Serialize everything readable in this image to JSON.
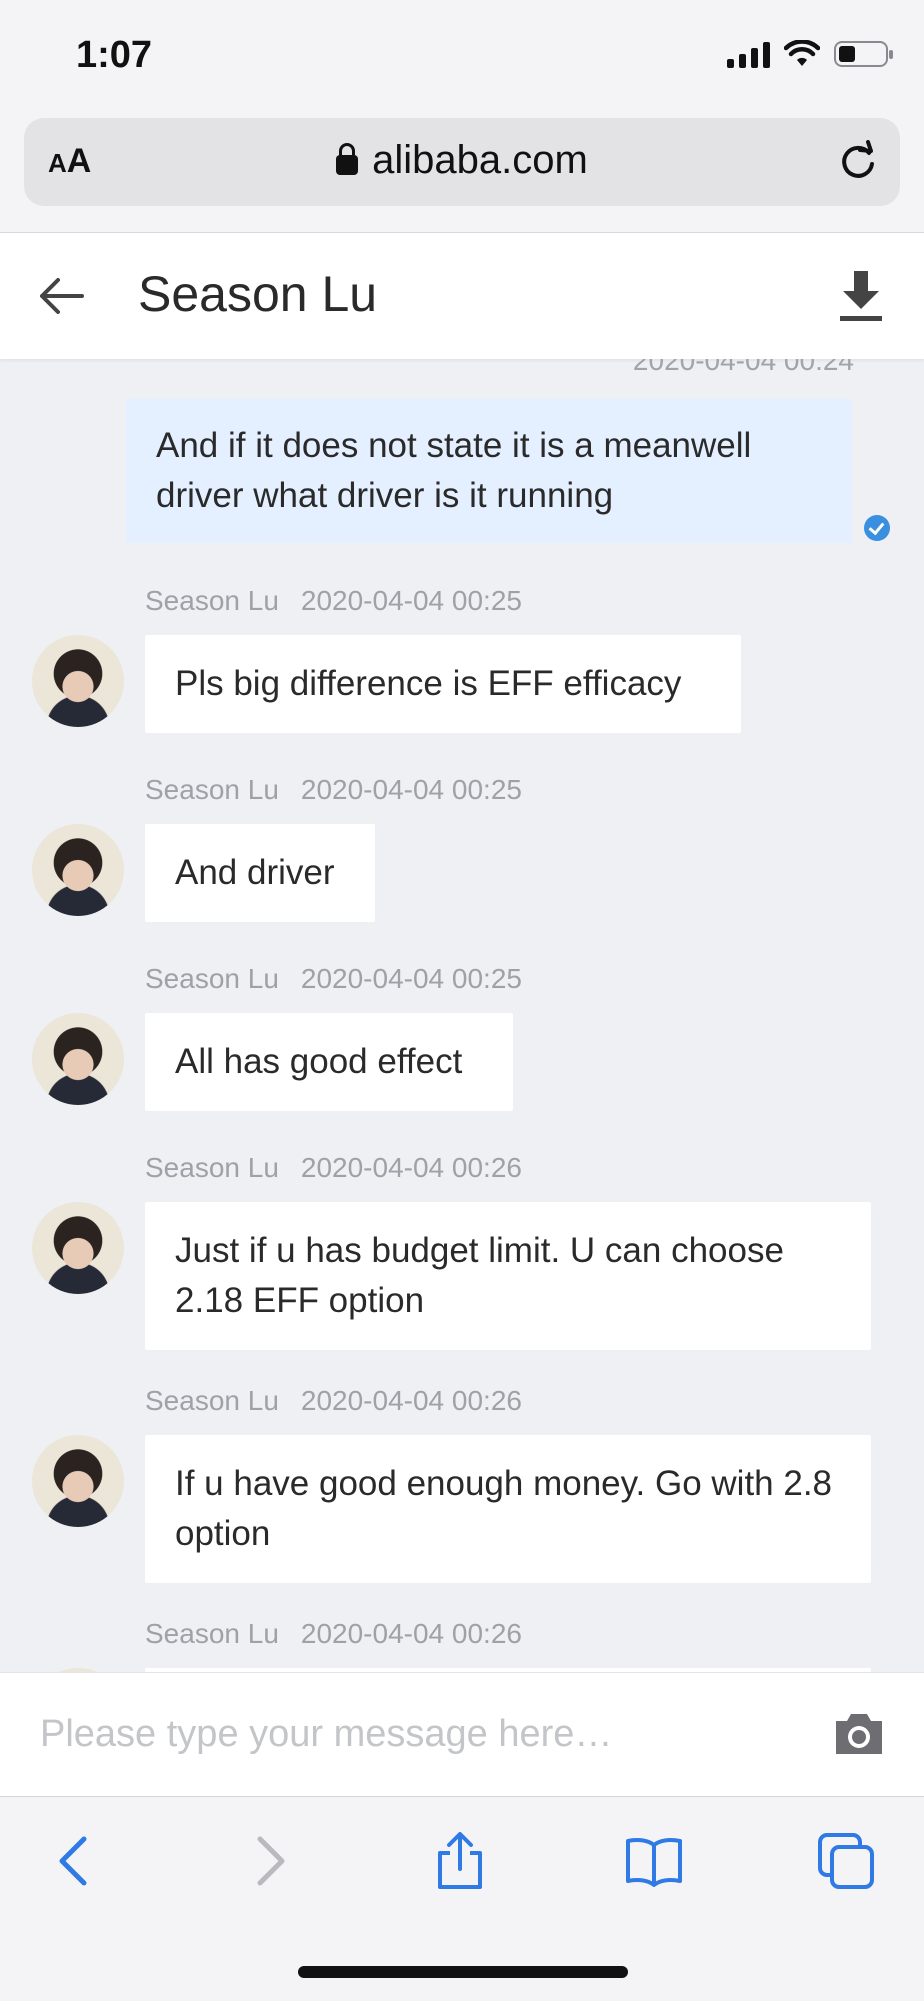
{
  "status_bar": {
    "time": "1:07"
  },
  "browser": {
    "aa_small": "A",
    "aa_large": "A",
    "url": "alibaba.com"
  },
  "header": {
    "title": "Season Lu"
  },
  "messages": {
    "cut_timestamp": "2020-04-04 00:24",
    "sent": {
      "text": "And if it does not state it is a meanwell driver what driver is it running"
    },
    "received": [
      {
        "sender": "Season Lu",
        "time": "2020-04-04 00:25",
        "text": "Pls big difference is EFF efficacy"
      },
      {
        "sender": "Season Lu",
        "time": "2020-04-04 00:25",
        "text": "And driver"
      },
      {
        "sender": "Season Lu",
        "time": "2020-04-04 00:25",
        "text": "All has good effect"
      },
      {
        "sender": "Season Lu",
        "time": "2020-04-04 00:26",
        "text": "Just if u has budget limit. U can choose 2.18 EFF option"
      },
      {
        "sender": "Season Lu",
        "time": "2020-04-04 00:26",
        "text": "If u have good enough money. Go with 2.8 option"
      },
      {
        "sender": "Season Lu",
        "time": "2020-04-04 00:26",
        "text": ""
      }
    ]
  },
  "input": {
    "placeholder": "Please type your message here…",
    "value": ""
  },
  "colors": {
    "sent_bubble": "#e4efff",
    "accent": "#2f7ae5",
    "read_check": "#3b8fe0"
  }
}
